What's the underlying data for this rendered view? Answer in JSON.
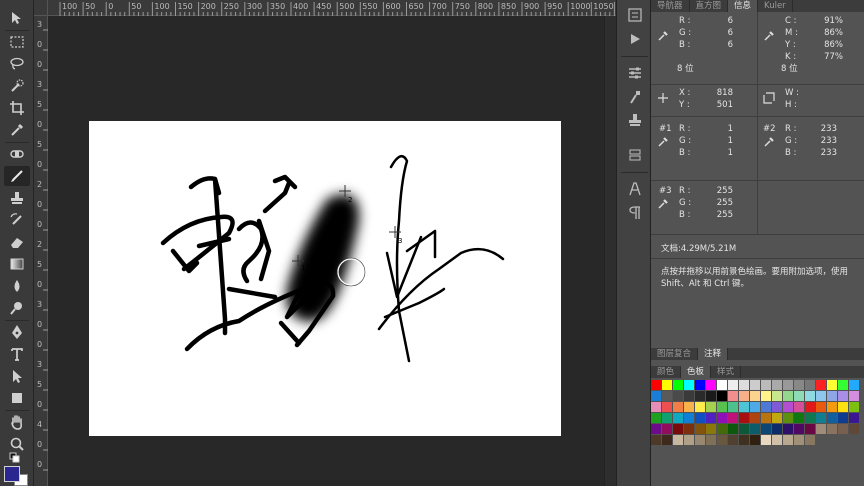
{
  "ruler_top": [
    "100",
    "50",
    "0",
    "50",
    "100",
    "150",
    "200",
    "250",
    "300",
    "350",
    "400",
    "450",
    "500",
    "550",
    "600",
    "650",
    "700",
    "750",
    "800",
    "850",
    "900",
    "950",
    "1000",
    "1050",
    "1100"
  ],
  "ruler_left": [
    "3",
    "0",
    "0",
    "3",
    "5",
    "0",
    "5",
    "0",
    "2",
    "0",
    "0",
    "2",
    "5",
    "0",
    "3",
    "0",
    "0",
    "3",
    "5",
    "0",
    "4",
    "0",
    "0"
  ],
  "panel_tabs_top": [
    {
      "label": "导航器"
    },
    {
      "label": "直方图"
    },
    {
      "label": "信息"
    },
    {
      "label": "Kuler"
    }
  ],
  "info": {
    "rgb": {
      "r_label": "R :",
      "g_label": "G :",
      "b_label": "B :",
      "r": "6",
      "g": "6",
      "b": "6",
      "bits": "8 位"
    },
    "cmyk": {
      "c_label": "C :",
      "m_label": "M :",
      "y_label": "Y :",
      "k_label": "K :",
      "c": "91%",
      "m": "86%",
      "y": "86%",
      "k": "77%",
      "bits": "8 位"
    },
    "xy": {
      "x_label": "X :",
      "y_label": "Y :",
      "x": "818",
      "y": "501"
    },
    "wh": {
      "w_label": "W :",
      "h_label": "H :"
    },
    "s1": {
      "id": "#1",
      "r_label": "R :",
      "g_label": "G :",
      "b_label": "B :",
      "r": "1",
      "g": "1",
      "b": "1"
    },
    "s2": {
      "id": "#2",
      "r_label": "R :",
      "g_label": "G :",
      "b_label": "B :",
      "r": "233",
      "g": "233",
      "b": "233"
    },
    "s3": {
      "id": "#3",
      "r_label": "R :",
      "g_label": "G :",
      "b_label": "B :",
      "r": "255",
      "g": "255",
      "b": "255"
    },
    "doc": "文档:4.29M/5.21M",
    "message": "点按并拖移以用前景色绘画。要用附加选项，使用 Shift、Alt 和 Ctrl 键。"
  },
  "panel_tabs_mid": [
    {
      "label": "图层复合"
    },
    {
      "label": "注释"
    }
  ],
  "panel_tabs_sw": [
    {
      "label": "颜色"
    },
    {
      "label": "色板"
    },
    {
      "label": "样式"
    }
  ],
  "canvas_markers": [
    "1",
    "2",
    "3"
  ],
  "swatches": [
    "#ff0000",
    "#ffff00",
    "#00ff00",
    "#00ffff",
    "#0000ff",
    "#ff00ff",
    "#ffffff",
    "#eeeeee",
    "#dddddd",
    "#cccccc",
    "#bbbbbb",
    "#aaaaaa",
    "#999999",
    "#888888",
    "#777777",
    "#ff2222",
    "#ffff33",
    "#33ff33",
    "#22aaff",
    "#1a7fd4",
    "#5a5a5a",
    "#4a4a4a",
    "#3a3a3a",
    "#2a2a2a",
    "#1a1a1a",
    "#000000",
    "#f28e8e",
    "#f5b08a",
    "#fbd28e",
    "#fff28a",
    "#c9e88e",
    "#94d68e",
    "#8edcb5",
    "#8ed9e2",
    "#8ec6ee",
    "#8ea6e6",
    "#a88ee6",
    "#d48ee0",
    "#e68eb8",
    "#ee5050",
    "#f27e47",
    "#f7b24c",
    "#fdeb4e",
    "#a4d24e",
    "#58c04e",
    "#4ec08e",
    "#4ec4d4",
    "#4eaae6",
    "#4e7ad6",
    "#7e5ad6",
    "#b44ed0",
    "#d44e98",
    "#e01a1a",
    "#e85a10",
    "#f29a10",
    "#fce010",
    "#7ec010",
    "#20a020",
    "#10a070",
    "#10a8c0",
    "#1080d6",
    "#1050c0",
    "#5020c0",
    "#9010b8",
    "#c0107a",
    "#a81010",
    "#b04410",
    "#b87410",
    "#c0a810",
    "#5e9010",
    "#107810",
    "#107850",
    "#107e90",
    "#1060a0",
    "#103c90",
    "#3c1890",
    "#6c0c8a",
    "#900c5c",
    "#780c0c",
    "#7e300c",
    "#84540c",
    "#8a780c",
    "#446a0c",
    "#0c580c",
    "#0c5838",
    "#0c5c6a",
    "#0c4674",
    "#0c2c6a",
    "#2c106a",
    "#500864",
    "#6a0844",
    "#a08c78",
    "#8a7460",
    "#786050",
    "#604838",
    "#4e3828",
    "#3e2a1c",
    "#c8b8a0",
    "#b0a088",
    "#988870",
    "#807058",
    "#685840",
    "#504030",
    "#403020",
    "#302010",
    "#e8d8c0",
    "#d0c0a8",
    "#b8a890",
    "#a09078",
    "#887860"
  ]
}
